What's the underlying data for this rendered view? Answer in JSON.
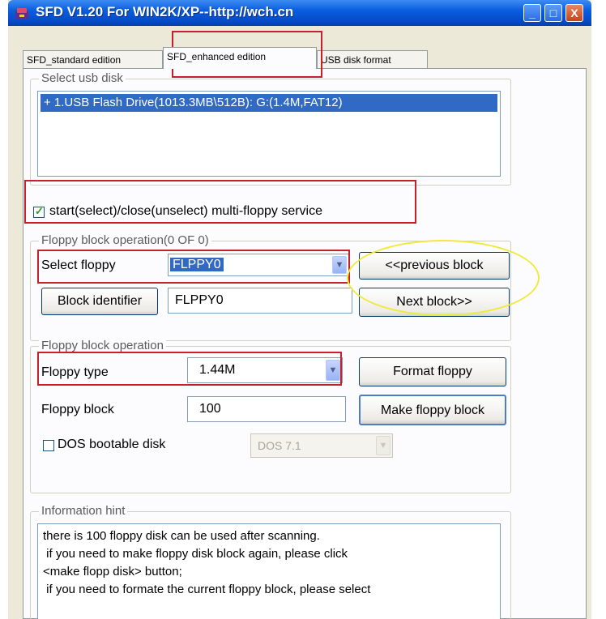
{
  "window": {
    "title": "SFD V1.20 For WIN2K/XP--http://wch.cn",
    "controls": {
      "minimize": "_",
      "maximize": "□",
      "close": "X"
    }
  },
  "tabs": [
    {
      "label": "SFD_standard edition"
    },
    {
      "label": "SFD_enhanced edition"
    },
    {
      "label": "USB disk format"
    }
  ],
  "select_usb": {
    "group_label": "Select usb disk",
    "items": [
      "+ 1.USB Flash Drive(1013.3MB\\512B): G:(1.4M,FAT12)"
    ]
  },
  "multi_floppy": {
    "label": "start(select)/close(unselect) multi-floppy service",
    "checked": true
  },
  "block_op1": {
    "group_label": "Floppy block operation(0 OF 0)",
    "select_floppy_label": "Select floppy",
    "select_floppy_value": "FLPPY0",
    "previous_button": "<<previous block",
    "block_identifier_button": "Block identifier",
    "block_identifier_value": "FLPPY0",
    "next_button": "Next block>>"
  },
  "block_op2": {
    "group_label": "Floppy block operation",
    "floppy_type_label": "Floppy type",
    "floppy_type_value": "1.44M",
    "format_button": "Format floppy",
    "floppy_block_label": "Floppy block",
    "floppy_block_value": "100",
    "make_button": "Make floppy block",
    "dos_label": "DOS bootable disk",
    "dos_checked": false,
    "dos_version": "DOS 7.1"
  },
  "info": {
    "group_label": "Information hint",
    "lines": [
      "there is 100 floppy disk can be used after scanning.",
      " if you need to make floppy disk block again, please click",
      "<make flopp disk> button;",
      " if you need to formate the current floppy block, please select"
    ]
  },
  "colors": {
    "annotation_red": "#c8202a",
    "annotation_yellow": "#f0ea3a",
    "selection_blue": "#316ac5"
  }
}
